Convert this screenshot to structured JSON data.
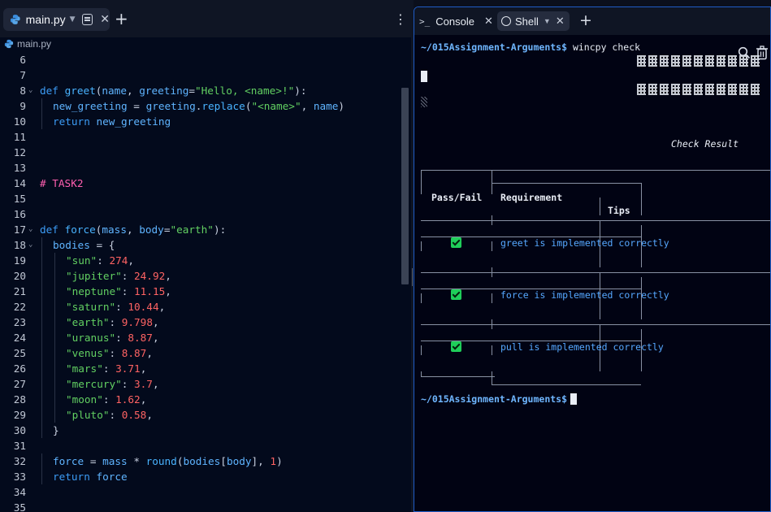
{
  "editor": {
    "tab": {
      "label": "main.py",
      "icon": "python-icon"
    },
    "breadcrumb": "main.py",
    "lines": [
      {
        "n": "6",
        "fold": false,
        "indent": 0,
        "tokens": []
      },
      {
        "n": "7",
        "fold": false,
        "indent": 0,
        "tokens": []
      },
      {
        "n": "8",
        "fold": true,
        "indent": 0,
        "tokens": [
          [
            "kw",
            "def "
          ],
          [
            "fn",
            "greet"
          ],
          [
            "txt",
            "("
          ],
          [
            "par",
            "name"
          ],
          [
            "txt",
            ", "
          ],
          [
            "par",
            "greeting"
          ],
          [
            "op",
            "="
          ],
          [
            "str",
            "\"Hello, <name>!\""
          ],
          [
            "txt",
            "):"
          ]
        ]
      },
      {
        "n": "9",
        "fold": false,
        "indent": 1,
        "tokens": [
          [
            "par",
            "new_greeting"
          ],
          [
            "op",
            " = "
          ],
          [
            "par",
            "greeting"
          ],
          [
            "txt",
            "."
          ],
          [
            "fn",
            "replace"
          ],
          [
            "txt",
            "("
          ],
          [
            "str",
            "\"<name>\""
          ],
          [
            "txt",
            ", "
          ],
          [
            "par",
            "name"
          ],
          [
            "txt",
            ")"
          ]
        ]
      },
      {
        "n": "10",
        "fold": false,
        "indent": 1,
        "tokens": [
          [
            "kw",
            "return "
          ],
          [
            "par",
            "new_greeting"
          ]
        ]
      },
      {
        "n": "11",
        "fold": false,
        "indent": 0,
        "tokens": []
      },
      {
        "n": "12",
        "fold": false,
        "indent": 0,
        "tokens": []
      },
      {
        "n": "13",
        "fold": false,
        "indent": 0,
        "tokens": []
      },
      {
        "n": "14",
        "fold": false,
        "indent": 0,
        "tokens": [
          [
            "cmt",
            "# TASK2"
          ]
        ]
      },
      {
        "n": "15",
        "fold": false,
        "indent": 0,
        "tokens": []
      },
      {
        "n": "16",
        "fold": false,
        "indent": 0,
        "tokens": []
      },
      {
        "n": "17",
        "fold": true,
        "indent": 0,
        "tokens": [
          [
            "kw",
            "def "
          ],
          [
            "fn",
            "force"
          ],
          [
            "txt",
            "("
          ],
          [
            "par",
            "mass"
          ],
          [
            "txt",
            ", "
          ],
          [
            "par",
            "body"
          ],
          [
            "op",
            "="
          ],
          [
            "str",
            "\"earth\""
          ],
          [
            "txt",
            "):"
          ]
        ]
      },
      {
        "n": "18",
        "fold": true,
        "indent": 1,
        "tokens": [
          [
            "par",
            "bodies"
          ],
          [
            "op",
            " = "
          ],
          [
            "txt",
            "{"
          ]
        ]
      },
      {
        "n": "19",
        "fold": false,
        "indent": 2,
        "tokens": [
          [
            "str",
            "\"sun\""
          ],
          [
            "txt",
            ": "
          ],
          [
            "num",
            "274"
          ],
          [
            "txt",
            ","
          ]
        ]
      },
      {
        "n": "20",
        "fold": false,
        "indent": 2,
        "tokens": [
          [
            "str",
            "\"jupiter\""
          ],
          [
            "txt",
            ": "
          ],
          [
            "num",
            "24.92"
          ],
          [
            "txt",
            ","
          ]
        ]
      },
      {
        "n": "21",
        "fold": false,
        "indent": 2,
        "tokens": [
          [
            "str",
            "\"neptune\""
          ],
          [
            "txt",
            ": "
          ],
          [
            "num",
            "11.15"
          ],
          [
            "txt",
            ","
          ]
        ]
      },
      {
        "n": "22",
        "fold": false,
        "indent": 2,
        "tokens": [
          [
            "str",
            "\"saturn\""
          ],
          [
            "txt",
            ": "
          ],
          [
            "num",
            "10.44"
          ],
          [
            "txt",
            ","
          ]
        ]
      },
      {
        "n": "23",
        "fold": false,
        "indent": 2,
        "tokens": [
          [
            "str",
            "\"earth\""
          ],
          [
            "txt",
            ": "
          ],
          [
            "num",
            "9.798"
          ],
          [
            "txt",
            ","
          ]
        ]
      },
      {
        "n": "24",
        "fold": false,
        "indent": 2,
        "tokens": [
          [
            "str",
            "\"uranus\""
          ],
          [
            "txt",
            ": "
          ],
          [
            "num",
            "8.87"
          ],
          [
            "txt",
            ","
          ]
        ]
      },
      {
        "n": "25",
        "fold": false,
        "indent": 2,
        "tokens": [
          [
            "str",
            "\"venus\""
          ],
          [
            "txt",
            ": "
          ],
          [
            "num",
            "8.87"
          ],
          [
            "txt",
            ","
          ]
        ]
      },
      {
        "n": "26",
        "fold": false,
        "indent": 2,
        "tokens": [
          [
            "str",
            "\"mars\""
          ],
          [
            "txt",
            ": "
          ],
          [
            "num",
            "3.71"
          ],
          [
            "txt",
            ","
          ]
        ]
      },
      {
        "n": "27",
        "fold": false,
        "indent": 2,
        "tokens": [
          [
            "str",
            "\"mercury\""
          ],
          [
            "txt",
            ": "
          ],
          [
            "num",
            "3.7"
          ],
          [
            "txt",
            ","
          ]
        ]
      },
      {
        "n": "28",
        "fold": false,
        "indent": 2,
        "tokens": [
          [
            "str",
            "\"moon\""
          ],
          [
            "txt",
            ": "
          ],
          [
            "num",
            "1.62"
          ],
          [
            "txt",
            ","
          ]
        ]
      },
      {
        "n": "29",
        "fold": false,
        "indent": 2,
        "tokens": [
          [
            "str",
            "\"pluto\""
          ],
          [
            "txt",
            ": "
          ],
          [
            "num",
            "0.58"
          ],
          [
            "txt",
            ","
          ]
        ]
      },
      {
        "n": "30",
        "fold": false,
        "indent": 1,
        "tokens": [
          [
            "txt",
            "}"
          ]
        ]
      },
      {
        "n": "31",
        "fold": false,
        "indent": 0,
        "tokens": []
      },
      {
        "n": "32",
        "fold": false,
        "indent": 1,
        "tokens": [
          [
            "par",
            "force"
          ],
          [
            "op",
            " = "
          ],
          [
            "par",
            "mass"
          ],
          [
            "op",
            " * "
          ],
          [
            "fn",
            "round"
          ],
          [
            "txt",
            "("
          ],
          [
            "par",
            "bodies"
          ],
          [
            "txt",
            "["
          ],
          [
            "par",
            "body"
          ],
          [
            "txt",
            "], "
          ],
          [
            "num",
            "1"
          ],
          [
            "txt",
            ")"
          ]
        ]
      },
      {
        "n": "33",
        "fold": false,
        "indent": 1,
        "tokens": [
          [
            "kw",
            "return "
          ],
          [
            "par",
            "force"
          ]
        ]
      },
      {
        "n": "34",
        "fold": false,
        "indent": 0,
        "tokens": []
      },
      {
        "n": "35",
        "fold": false,
        "indent": 0,
        "tokens": []
      }
    ]
  },
  "console": {
    "tabs": [
      {
        "label": "Console",
        "icon": "terminal-prompt-icon"
      },
      {
        "label": "Shell",
        "icon": "shell-icon"
      }
    ],
    "prompt": "~/015Assignment-Arguments$",
    "command": "wincpy check",
    "check_title": "Check Result",
    "headers": {
      "pass_fail": "Pass/Fail",
      "requirement": "Requirement",
      "tips": "Tips"
    },
    "rows": [
      {
        "status": "pass",
        "requirement": "greet is implemented correctly"
      },
      {
        "status": "pass",
        "requirement": "force is implemented correctly"
      },
      {
        "status": "pass",
        "requirement": "pull is implemented correctly"
      }
    ],
    "final_prompt": "~/015Assignment-Arguments$"
  },
  "colors": {
    "accent_border": "#1f5cc6",
    "keyword": "#3c9cf6",
    "string": "#62d062",
    "number": "#ff6363",
    "comment": "#ff5fb0",
    "pass_check": "#1fce5a"
  }
}
